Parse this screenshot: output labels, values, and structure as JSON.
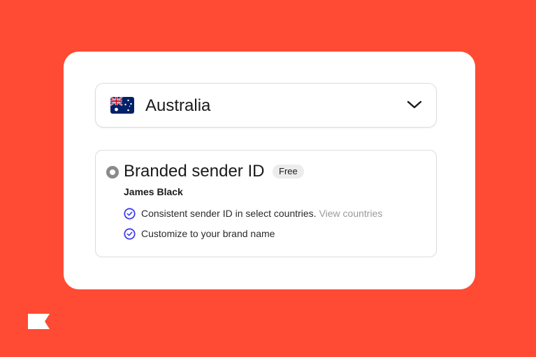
{
  "country_select": {
    "flag_icon": "australia-flag-icon",
    "value": "Australia",
    "chevron_icon": "chevron-down-icon"
  },
  "option": {
    "title": "Branded sender ID",
    "badge": "Free",
    "sender_name": "James Black",
    "features": [
      {
        "text": "Consistent sender ID in select countries.",
        "link": "View countries",
        "icon": "check-circle-icon"
      },
      {
        "text": "Customize to your brand name",
        "icon": "check-circle-icon"
      }
    ]
  },
  "colors": {
    "background": "#ff4b33",
    "card": "#ffffff",
    "check_accent": "#3d3df0",
    "link": "#9a9a9a",
    "radio": "#8a8a8a"
  },
  "brand": {
    "logo_icon": "flag-logo-icon"
  }
}
